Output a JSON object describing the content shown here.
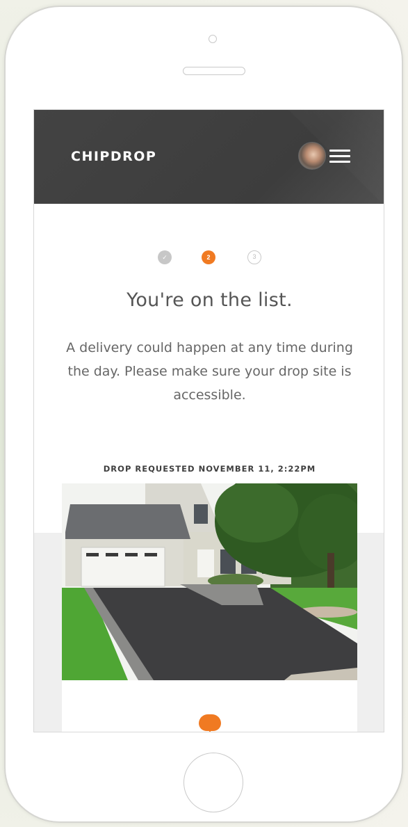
{
  "app": {
    "logo": "CHIPDROP"
  },
  "header": {
    "avatar": "user-avatar",
    "menu_icon": "hamburger-menu-icon"
  },
  "steps": [
    {
      "label": "",
      "state": "complete"
    },
    {
      "label": "2",
      "state": "current"
    },
    {
      "label": "3",
      "state": "upcoming"
    }
  ],
  "status": {
    "title": "You're on the list.",
    "message": "A delivery could happen at any time during the day. Please make sure your drop site is accessible."
  },
  "drop": {
    "requested_label": "DROP REQUESTED NOVEMBER 11, 2:22PM",
    "photo": "house-driveway-photo",
    "pin_icon": "map-pin-icon"
  },
  "colors": {
    "accent": "#f07a22",
    "header_bg": "#434343"
  }
}
